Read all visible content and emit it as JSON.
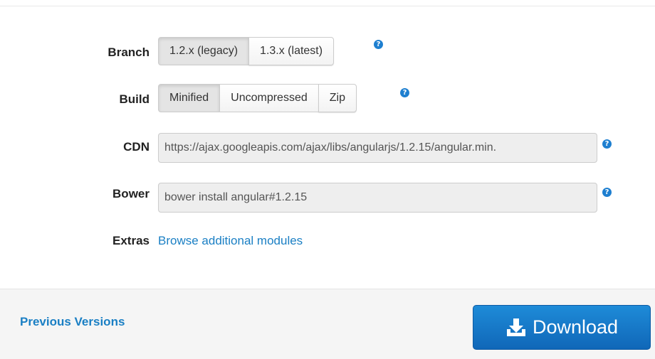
{
  "branch": {
    "label": "Branch",
    "options": [
      "1.2.x (legacy)",
      "1.3.x (latest)"
    ],
    "selected": "1.2.x (legacy)",
    "help": "?"
  },
  "build": {
    "label": "Build",
    "options": [
      "Minified",
      "Uncompressed",
      "Zip"
    ],
    "selected": "Minified",
    "help": "?"
  },
  "cdn": {
    "label": "CDN",
    "value": "https://ajax.googleapis.com/ajax/libs/angularjs/1.2.15/angular.min.",
    "help": "?"
  },
  "bower": {
    "label": "Bower",
    "value": "bower install angular#1.2.15",
    "help": "?"
  },
  "extras": {
    "label": "Extras",
    "link": "Browse additional modules"
  },
  "footer": {
    "previous_versions": "Previous Versions",
    "download_label": "Download"
  },
  "colors": {
    "accent": "#1a7fc4",
    "download_bg": "#1473c7",
    "help_icon": "#1e7fd0"
  },
  "icons": {
    "download": "download-tray-icon",
    "help": "question-circle-icon"
  }
}
